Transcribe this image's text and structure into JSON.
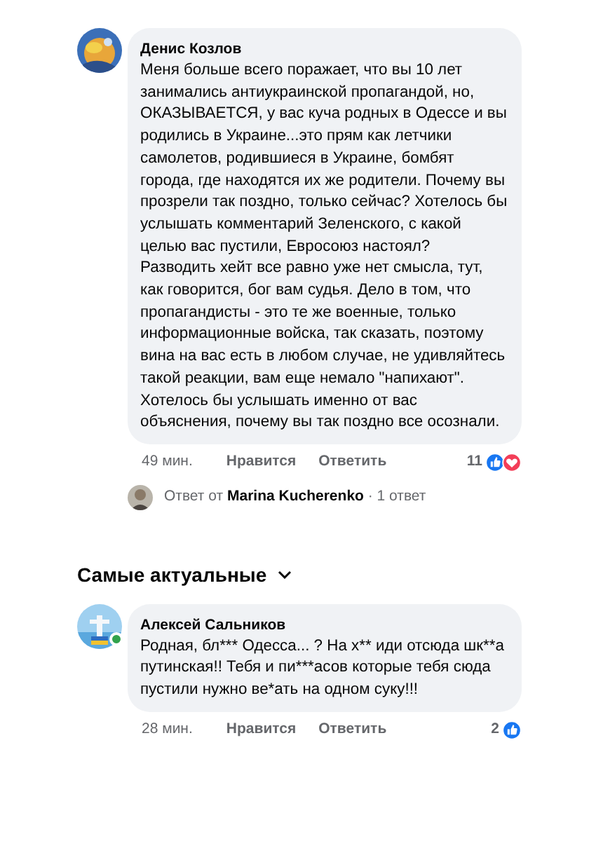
{
  "comments": [
    {
      "author": "Денис Козлов",
      "online": false,
      "text": "Меня больше всего поражает, что вы 10 лет занимались антиукраинской пропагандой, но, ОКАЗЫВАЕТСЯ, у вас куча родных в Одессе и вы родились в Украине...это прям как летчики самолетов, родившиеся в Украине, бомбят города, где находятся их же родители. Почему вы прозрели так поздно, только сейчас? Хотелось бы услышать комментарий Зеленского, с какой целью вас пустили, Евросоюз настоял? Разводить хейт все равно уже нет смысла, тут, как говорится, бог вам судья. Дело в том, что пропагандисты - это те же военные, только информационные войска, так сказать, поэтому вина на вас есть в любом случае, не удивляйтесь такой реакции, вам еще немало \"напихают\". Хотелось бы услышать именно от вас объяснения, почему вы так поздно все осознали.",
      "time": "49 мин.",
      "like_label": "Нравится",
      "reply_label": "Ответить",
      "reaction_count": "11",
      "reactions": [
        {
          "kind": "like"
        },
        {
          "kind": "love"
        }
      ],
      "reply_summary": "Ответ от **Marina Kucherenko** · 1 ответ"
    },
    {
      "author": "Алексей Сальников",
      "online": true,
      "text": "Родная, бл*** Одесса... ? На х** иди отсюда шк**а путинская!! Тебя и пи***асов которые тебя сюда пустили нужно ве*ать на одном суку!!!",
      "time": "28 мин.",
      "like_label": "Нравится",
      "reply_label": "Ответить",
      "reaction_count": "2",
      "reactions": [
        {
          "kind": "like"
        }
      ]
    }
  ],
  "sort_label": "Самые актуальные"
}
